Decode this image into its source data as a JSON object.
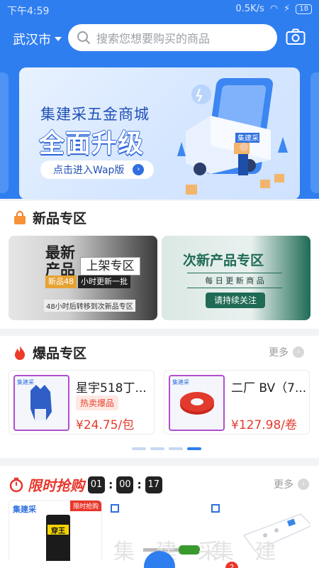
{
  "status_bar": {
    "time": "下午4:59",
    "network_speed": "0.5K/s",
    "battery": "18"
  },
  "header": {
    "city": "武汉市",
    "search_placeholder": "搜索您想要购买的商品"
  },
  "banner": {
    "title": "集建采五金商城",
    "headline": "全面升级",
    "cta_label": "点击进入Wap版",
    "truck_label": "集建采"
  },
  "new_zone": {
    "title": "新品专区",
    "card1": {
      "big_text_1": "最新",
      "big_text_2": "产品",
      "label": "上架专区",
      "strip": "新品48",
      "strip2": "小时更新一批",
      "note": "48小时后转移到次新品专区"
    },
    "card2": {
      "title": "次新产品专区",
      "sub": "每 日 更 新 商 品",
      "button": "请持续关注"
    }
  },
  "hot_zone": {
    "title": "爆品专区",
    "more_label": "更多",
    "items": [
      {
        "name": "星宇518丁...",
        "tag": "热卖爆品",
        "price": "¥24.75/包",
        "logo": "集建采"
      },
      {
        "name": "二厂 BV（7...",
        "tag": "",
        "price": "¥127.98/卷",
        "logo": "集建采"
      }
    ],
    "pager_count": 4,
    "pager_active": 3
  },
  "flash_sale": {
    "title": "限时抢购",
    "hours": "01",
    "minutes": "00",
    "seconds": "17",
    "more_label": "更多",
    "card1_logo": "集建采",
    "card1_ribbon": "限时抢购",
    "card1_product": "穿王",
    "watermark": "集 建 采"
  },
  "tabbar": {
    "badge_count": "2"
  },
  "colors": {
    "brand_blue": "#2f7ef0",
    "price_red": "#e43b2c"
  }
}
